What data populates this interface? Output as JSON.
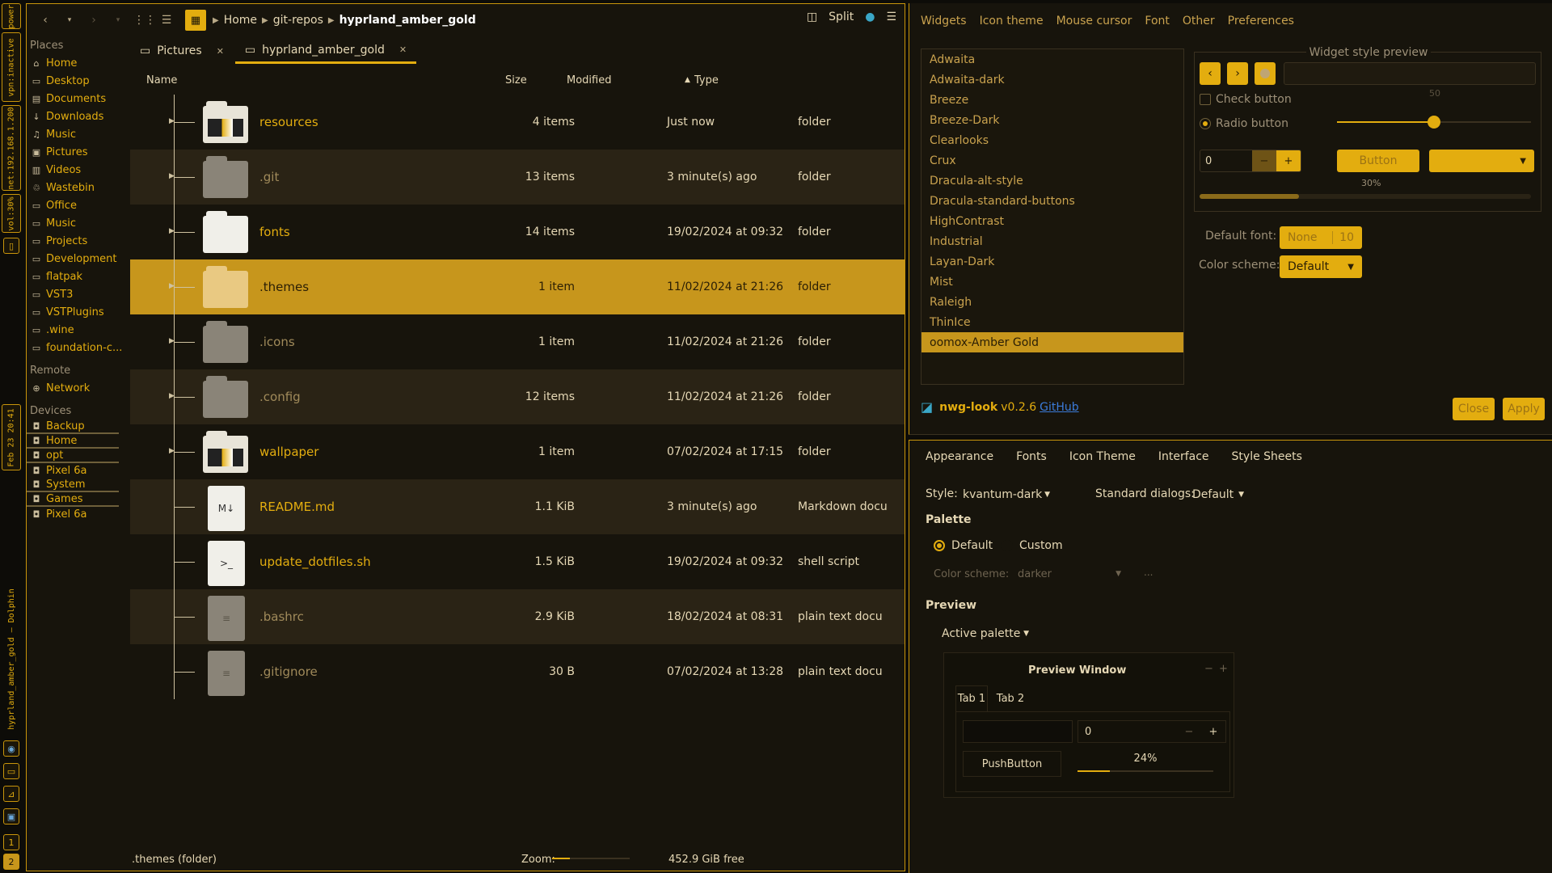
{
  "bar": {
    "power": "power",
    "vpn": "vpn:inactive",
    "net": "net:192.168.1.200",
    "vol": "vol:30%",
    "date": "Feb 23 20:41",
    "title": "hyprland_amber_gold — Dolphin",
    "ws": "1",
    "ws2": "2"
  },
  "dolphin": {
    "breadcrumbs": [
      "Home",
      "git-repos",
      "hyprland_amber_gold"
    ],
    "split_label": "Split",
    "sidebar": {
      "places_header": "Places",
      "places": [
        {
          "label": "Home",
          "icon": "home-icon"
        },
        {
          "label": "Desktop",
          "icon": "desktop-icon"
        },
        {
          "label": "Documents",
          "icon": "documents-icon"
        },
        {
          "label": "Downloads",
          "icon": "download-icon"
        },
        {
          "label": "Music",
          "icon": "music-icon"
        },
        {
          "label": "Pictures",
          "icon": "pictures-icon"
        },
        {
          "label": "Videos",
          "icon": "videos-icon"
        },
        {
          "label": "Wastebin",
          "icon": "trash-icon"
        },
        {
          "label": "Office",
          "icon": "folder-icon"
        },
        {
          "label": "Music",
          "icon": "folder-icon"
        },
        {
          "label": "Projects",
          "icon": "folder-icon"
        },
        {
          "label": "Development",
          "icon": "folder-icon"
        },
        {
          "label": "flatpak",
          "icon": "folder-icon"
        },
        {
          "label": "VST3",
          "icon": "folder-icon"
        },
        {
          "label": "VSTPlugins",
          "icon": "folder-icon"
        },
        {
          "label": ".wine",
          "icon": "folder-icon"
        },
        {
          "label": "foundation-c...",
          "icon": "folder-icon"
        }
      ],
      "remote_header": "Remote",
      "remote": [
        {
          "label": "Network",
          "icon": "network-icon"
        }
      ],
      "devices_header": "Devices",
      "devices": [
        {
          "label": "Backup",
          "bar": true
        },
        {
          "label": "Home",
          "bar": true
        },
        {
          "label": "opt",
          "bar": true
        },
        {
          "label": "Pixel 6a",
          "bar": false
        },
        {
          "label": "System",
          "bar": true
        },
        {
          "label": "Games",
          "bar": true
        },
        {
          "label": "Pixel 6a",
          "bar": false
        }
      ]
    },
    "tabs": [
      {
        "label": "Pictures"
      },
      {
        "label": "hyprland_amber_gold"
      }
    ],
    "columns": {
      "name": "Name",
      "size": "Size",
      "modified": "Modified",
      "type": "Type"
    },
    "files": [
      {
        "name": "resources",
        "size": "4 items",
        "modified": "Just now",
        "type": "folder",
        "kind": "folder-img"
      },
      {
        "name": ".git",
        "size": "13 items",
        "modified": "3 minute(s) ago",
        "type": "folder",
        "kind": "folder-gray"
      },
      {
        "name": "fonts",
        "size": "14 items",
        "modified": "19/02/2024 at 09:32",
        "type": "folder",
        "kind": "folder-white"
      },
      {
        "name": ".themes",
        "size": "1 item",
        "modified": "11/02/2024 at 21:26",
        "type": "folder",
        "kind": "folder-sel"
      },
      {
        "name": ".icons",
        "size": "1 item",
        "modified": "11/02/2024 at 21:26",
        "type": "folder",
        "kind": "folder-gray"
      },
      {
        "name": ".config",
        "size": "12 items",
        "modified": "11/02/2024 at 21:26",
        "type": "folder",
        "kind": "folder-gray"
      },
      {
        "name": "wallpaper",
        "size": "1 item",
        "modified": "07/02/2024 at 17:15",
        "type": "folder",
        "kind": "folder-img"
      },
      {
        "name": "README.md",
        "size": "1.1 KiB",
        "modified": "3 minute(s) ago",
        "type": "Markdown docu",
        "kind": "md"
      },
      {
        "name": "update_dotfiles.sh",
        "size": "1.5 KiB",
        "modified": "19/02/2024 at 09:32",
        "type": "shell script",
        "kind": "sh"
      },
      {
        "name": ".bashrc",
        "size": "2.9 KiB",
        "modified": "18/02/2024 at 08:31",
        "type": "plain text docu",
        "kind": "txt"
      },
      {
        "name": ".gitignore",
        "size": "30 B",
        "modified": "07/02/2024 at 13:28",
        "type": "plain text docu",
        "kind": "txt"
      }
    ],
    "status": {
      "selection": ".themes (folder)",
      "zoom_label": "Zoom:",
      "free": "452.9 GiB free"
    }
  },
  "nwg": {
    "tabs": [
      "Widgets",
      "Icon theme",
      "Mouse cursor",
      "Font",
      "Other",
      "Preferences"
    ],
    "themes": [
      "Adwaita",
      "Adwaita-dark",
      "Breeze",
      "Breeze-Dark",
      "Clearlooks",
      "Crux",
      "Dracula-alt-style",
      "Dracula-standard-buttons",
      "HighContrast",
      "Industrial",
      "Layan-Dark",
      "Mist",
      "Raleigh",
      "ThinIce",
      "oomox-Amber Gold"
    ],
    "selected_theme": "oomox-Amber Gold",
    "preview_title": "Widget style preview",
    "check_label": "Check button",
    "radio_label": "Radio button",
    "slider_value": "50",
    "slider_level": 0.5,
    "spin_value": "0",
    "button_label": "Button",
    "progress_label": "30%",
    "progress": 0.3,
    "default_font_label": "Default font:",
    "font_name": "None",
    "font_size": "10",
    "color_scheme_label": "Color scheme:",
    "color_scheme": "Default",
    "app_name": "nwg-look",
    "version": "v0.2.6",
    "github": "GitHub",
    "close": "Close",
    "apply": "Apply"
  },
  "qt": {
    "tabs": [
      "Appearance",
      "Fonts",
      "Icon Theme",
      "Interface",
      "Style Sheets"
    ],
    "style_label": "Style:",
    "style": "kvantum-dark",
    "dialogs_label": "Standard dialogs:",
    "dialogs": "Default",
    "palette_label": "Palette",
    "default_label": "Default",
    "custom_label": "Custom",
    "scheme_label": "Color scheme:",
    "scheme": "darker",
    "dots": "...",
    "preview_label": "Preview",
    "active_palette": "Active palette",
    "pw_title": "Preview Window",
    "pw_tab1": "Tab 1",
    "pw_tab2": "Tab 2",
    "pw_spin": "0",
    "pw_push": "PushButton",
    "pw_progress": "24%",
    "pw_progress_level": 0.24
  },
  "colors": {
    "accent": "#e3ad0f",
    "selection": "#c7961c",
    "bg": "#17140c"
  }
}
